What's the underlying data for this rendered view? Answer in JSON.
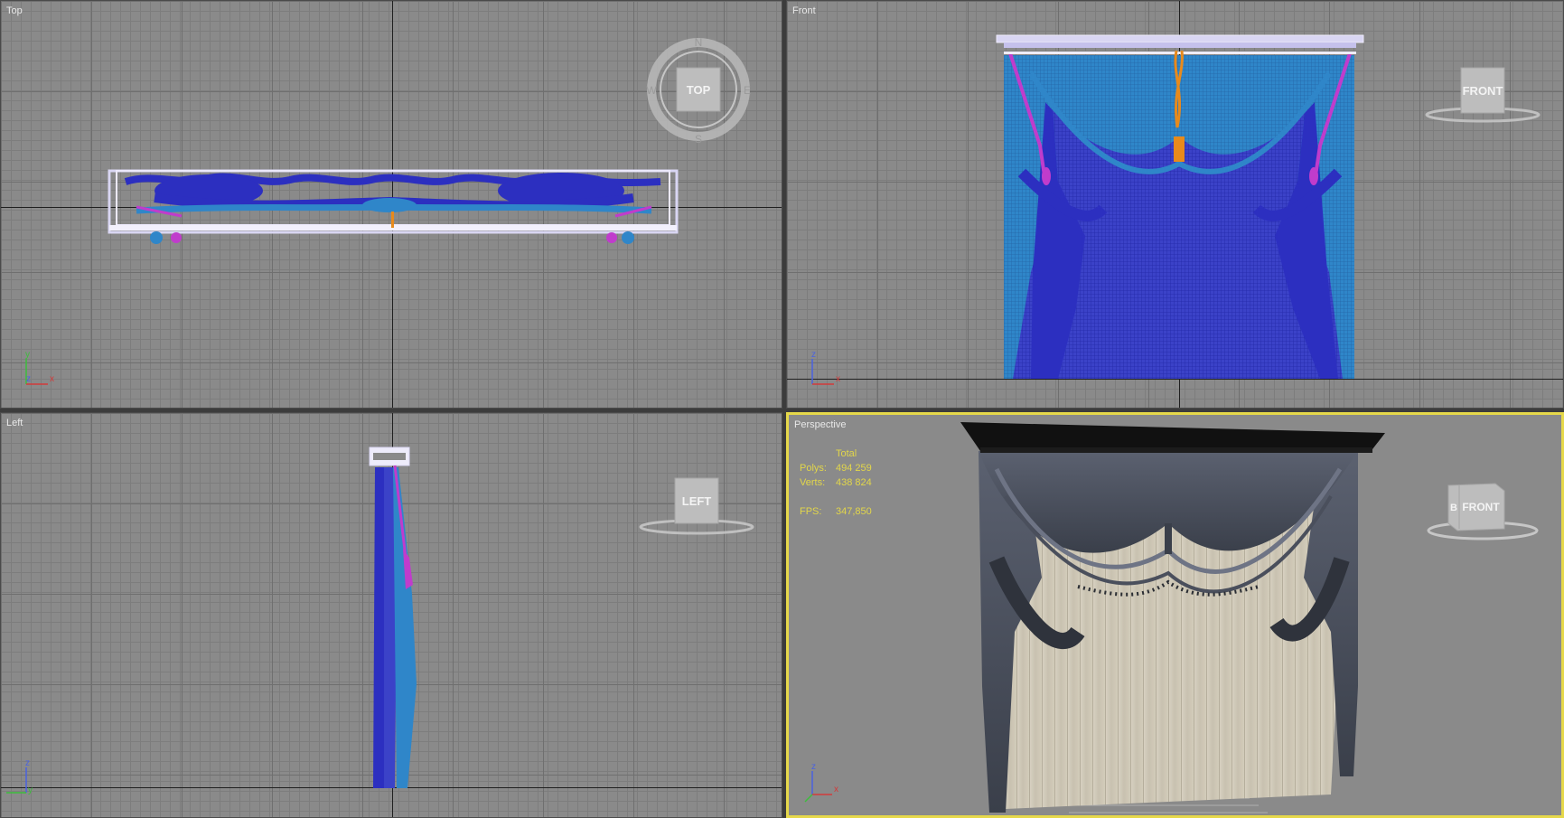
{
  "viewports": {
    "top": {
      "label": "Top",
      "cube": "TOP",
      "compass": [
        "N",
        "W",
        "E",
        "S"
      ],
      "axes": [
        "y",
        "z",
        "x"
      ]
    },
    "front": {
      "label": "Front",
      "cube": "FRONT",
      "axes": [
        "z",
        "x"
      ]
    },
    "left": {
      "label": "Left",
      "cube": "LEFT",
      "axes": [
        "z",
        "y"
      ]
    },
    "perspective": {
      "label": "Perspective",
      "cube": "FRONT",
      "cube_side": "B",
      "axes": [
        "z",
        "x"
      ],
      "stats": {
        "header": "Total",
        "polys_label": "Polys:",
        "polys_value": "494 259",
        "verts_label": "Verts:",
        "verts_value": "438 824",
        "fps_label": "FPS:",
        "fps_value": "347,850"
      }
    }
  },
  "colors": {
    "grid": "#8a8a8a",
    "active_border": "#e6d84a",
    "curtain_dark": "#2c2fc0",
    "curtain_light": "#2f86c9",
    "tieback": "#c03ccc",
    "tassel": "#e88a1c",
    "rail": "#d9d6f3"
  }
}
